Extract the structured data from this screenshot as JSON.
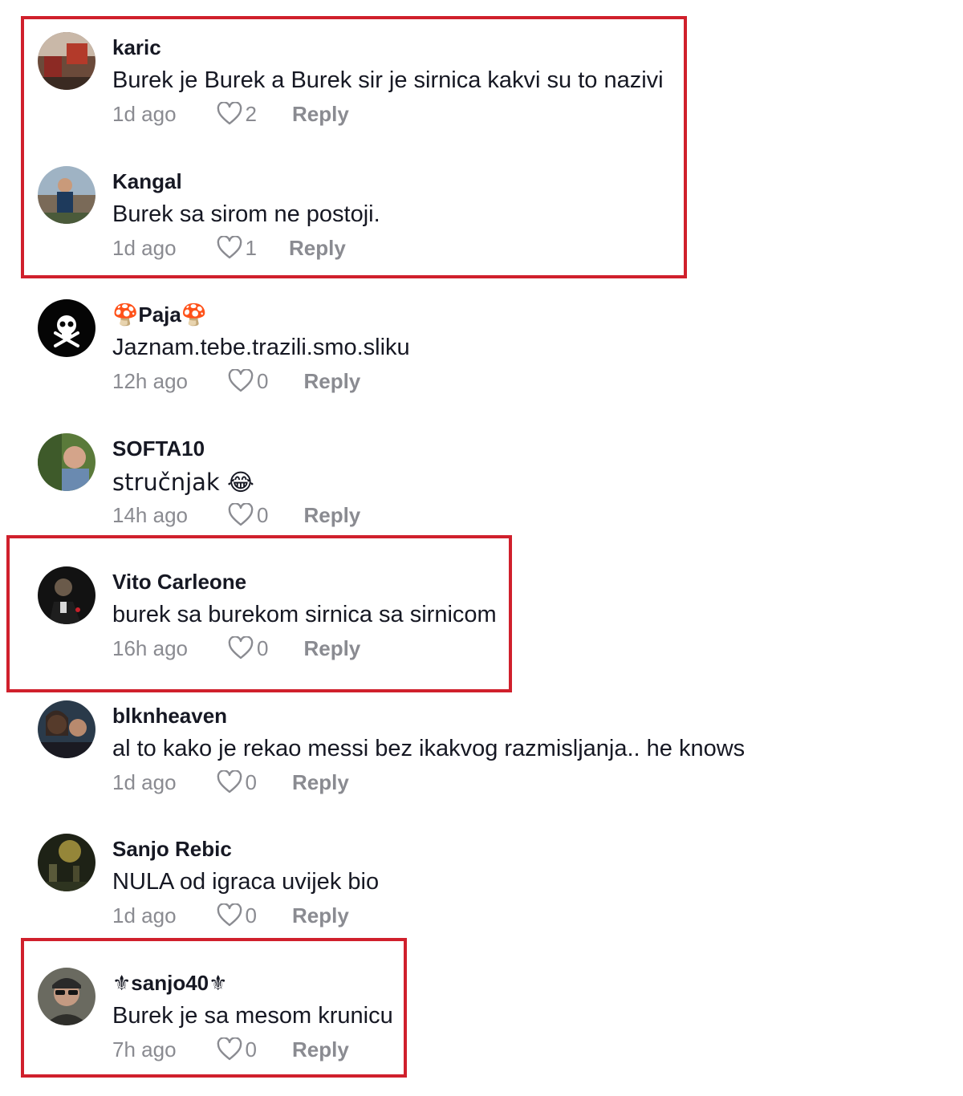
{
  "accent_color": "#d0202c",
  "comments": [
    {
      "user": "karic",
      "text": "Burek je Burek a Burek sir je sirnica kakvi su to nazivi",
      "time": "1d ago",
      "likes": "2",
      "reply": "Reply",
      "avatar": "photo-avatar"
    },
    {
      "user": "Kangal",
      "text": "Burek sa sirom ne postoji.",
      "time": "1d ago",
      "likes": "1",
      "reply": "Reply",
      "avatar": "photo-avatar"
    },
    {
      "user": "🍄Paja🍄",
      "text": "Jaznam.tebe.trazili.smo.sliku",
      "time": "12h ago",
      "likes": "0",
      "reply": "Reply",
      "avatar": "skull-crossbones-avatar"
    },
    {
      "user": "SOFTA10",
      "text": "stručnjak 😂",
      "time": "14h ago",
      "likes": "0",
      "reply": "Reply",
      "avatar": "photo-avatar"
    },
    {
      "user": "Vito Carleone",
      "text": "burek sa burekom sirnica sa sirnicom",
      "time": "16h ago",
      "likes": "0",
      "reply": "Reply",
      "avatar": "photo-avatar"
    },
    {
      "user": "blknheaven",
      "text": "al to kako je rekao messi bez ikakvog razmisljanja.. he knows",
      "time": "1d ago",
      "likes": "0",
      "reply": "Reply",
      "avatar": "photo-avatar"
    },
    {
      "user": "Sanjo Rebic",
      "text": "NULA od igraca uvijek bio",
      "time": "1d ago",
      "likes": "0",
      "reply": "Reply",
      "avatar": "photo-avatar"
    },
    {
      "user": "⚜sanjo40⚜",
      "text": "Burek je sa mesom krunicu",
      "time": "7h ago",
      "likes": "0",
      "reply": "Reply",
      "avatar": "photo-avatar"
    }
  ]
}
